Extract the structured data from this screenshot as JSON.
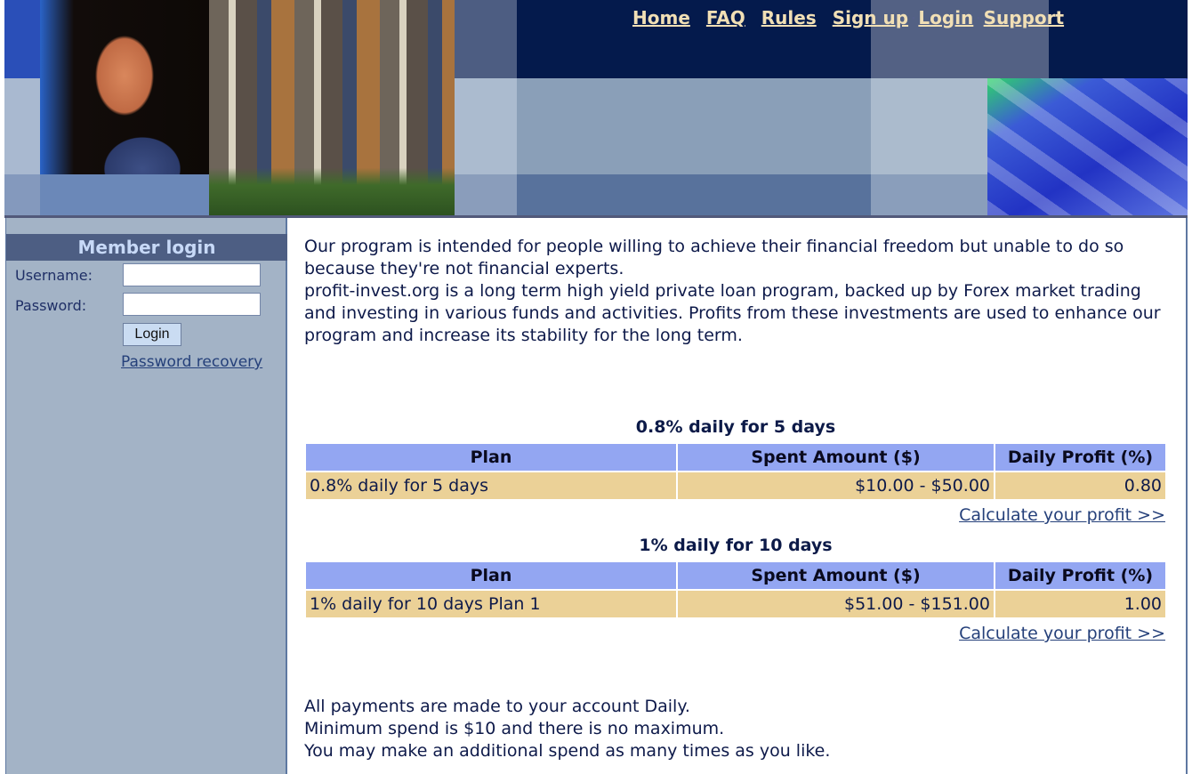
{
  "nav": {
    "links": [
      {
        "label": "Home"
      },
      {
        "label": "FAQ"
      },
      {
        "label": "Rules"
      },
      {
        "label": "Sign up"
      },
      {
        "label": "Login"
      },
      {
        "label": "Support"
      }
    ],
    "separator": "·"
  },
  "sidebar": {
    "title": "Member login",
    "username_label": "Username:",
    "username_value": "",
    "password_label": "Password:",
    "password_value": "",
    "login_button": "Login",
    "recovery_link": "Password recovery"
  },
  "main": {
    "intro": [
      "Our program is intended for people willing to achieve their financial freedom but unable to do so because they're not financial experts.",
      "profit-invest.org is a long term high yield private loan program, backed up by Forex market trading and investing in various funds and activities. Profits from these investments are used to enhance our program and increase its stability for the long term."
    ],
    "columns": [
      "Plan",
      "Spent Amount ($)",
      "Daily Profit (%)"
    ],
    "plans": [
      {
        "title": "0.8% daily for 5 days",
        "row": {
          "plan": "0.8% daily for 5 days",
          "amount": "$10.00 - $50.00",
          "profit": "0.80"
        },
        "calc_link": "Calculate your profit >>"
      },
      {
        "title": "1% daily for 10 days",
        "row": {
          "plan": "1% daily for 10 days Plan 1",
          "amount": "$51.00 - $151.00",
          "profit": "1.00"
        },
        "calc_link": "Calculate your profit >>"
      }
    ],
    "footer_notes": [
      "All payments are made to your account Daily.",
      "Minimum spend is $10 and there is no maximum.",
      "You may make an additional spend as many times as you like."
    ]
  },
  "colors": {
    "header_dark": "#041a4c",
    "nav_link": "#f1dfb5",
    "sidebar_bg": "#a3b3c6",
    "login_title_bg": "#4d5e83",
    "table_header_bg": "#93a6f2",
    "table_row_bg": "#ebd197",
    "link": "#25407a"
  }
}
